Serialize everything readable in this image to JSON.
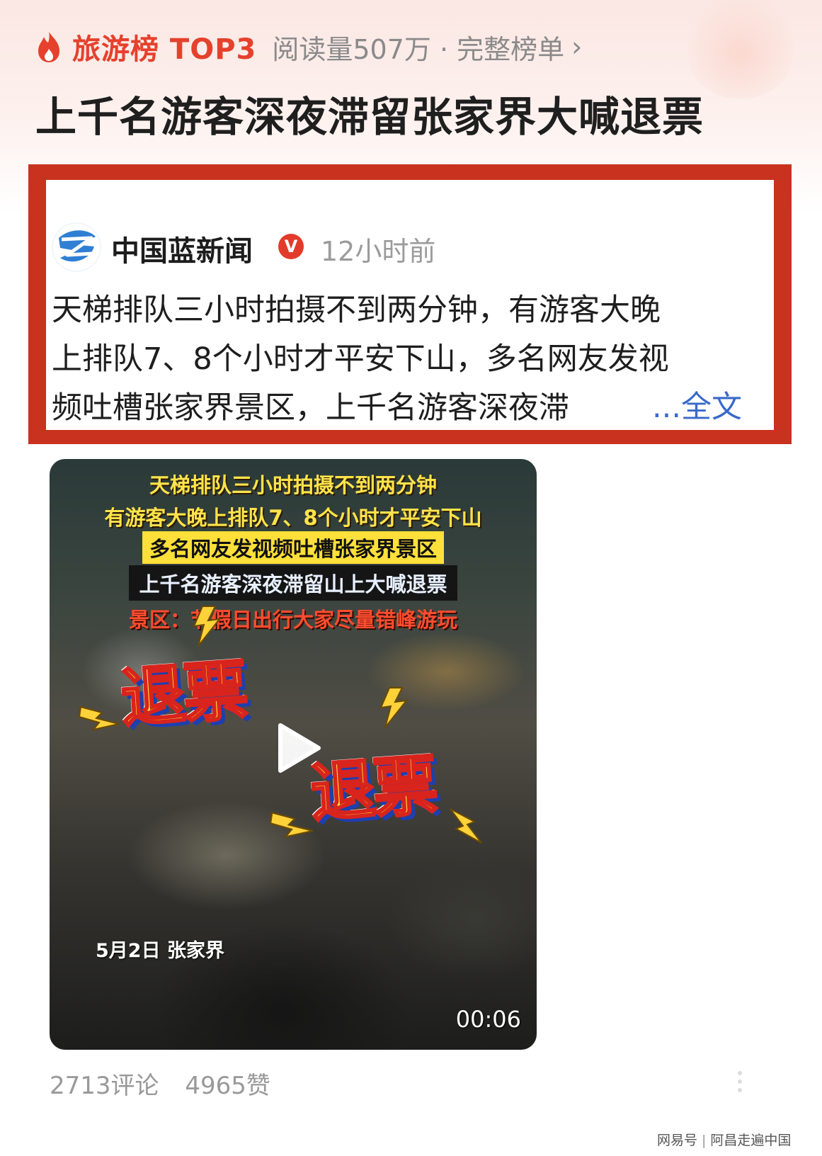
{
  "rank": {
    "label": "旅游榜 TOP3",
    "meta": "阅读量507万 · 完整榜单",
    "chevron": "›"
  },
  "headline": "上千名游客深夜滞留张家界大喊退票",
  "post": {
    "source_name": "中国蓝新闻",
    "verified_mark": "V",
    "time": "12小时前",
    "text_lines": [
      "天梯排队三小时拍摄不到两分钟，有游客大晚",
      "上排队7、8个小时才平安下山，多名网友发视",
      "频吐槽张家界景区，上千名游客深夜滞"
    ],
    "more": "...全文"
  },
  "video": {
    "overlay_lines": [
      "天梯排队三小时拍摄不到两分钟",
      "有游客大晚上排队7、8个小时才平安下山",
      "多名网友发视频吐槽张家界景区",
      "上千名游客深夜滞留山上大喊退票",
      "景区：节假日出行大家尽量错峰游玩"
    ],
    "big_words": [
      "退票",
      "退票"
    ],
    "date_location": "5月2日 张家界",
    "duration": "00:06"
  },
  "stats": {
    "comments": "2713评论",
    "likes": "4965赞"
  },
  "watermark": {
    "platform": "网易号",
    "separator": "|",
    "account": "阿昌走遍中国"
  },
  "colors": {
    "accent_red": "#e5412d",
    "card_border": "#c8321f",
    "link_blue": "#3a69c9"
  },
  "icons": [
    "fire-icon",
    "verified-icon",
    "play-icon",
    "chevron-right-icon",
    "more-dots-icon"
  ]
}
